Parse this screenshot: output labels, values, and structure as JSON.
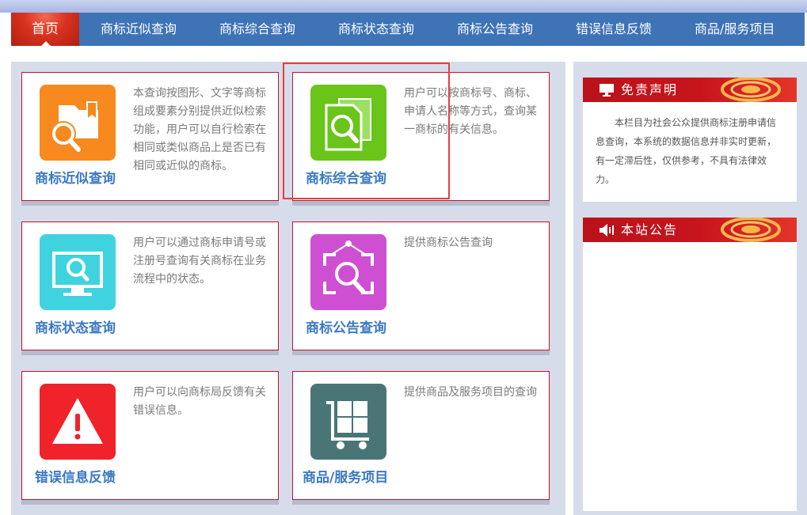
{
  "nav": {
    "home": "首页",
    "items": [
      "商标近似查询",
      "商标综合查询",
      "商标状态查询",
      "商标公告查询",
      "错误信息反馈",
      "商品/服务项目"
    ]
  },
  "cards": [
    {
      "title": "商标近似查询",
      "desc": "本查询按图形、文字等商标组成要素分别提供近似检索功能，用户可以自行检索在相同或类似商品上是否已有相同或近似的商标。",
      "icon": "folder-search-icon",
      "color": "#f7891e"
    },
    {
      "title": "商标综合查询",
      "desc": "用户可以按商标号、商标、申请人名称等方式，查询某一商标的有关信息。",
      "icon": "documents-search-icon",
      "color": "#69c51a"
    },
    {
      "title": "商标状态查询",
      "desc": "用户可以通过商标申请号或注册号查询有关商标在业务流程中的状态。",
      "icon": "monitor-search-icon",
      "color": "#3fd3e0"
    },
    {
      "title": "商标公告查询",
      "desc": "提供商标公告查询",
      "icon": "notice-board-search-icon",
      "color": "#cf4fd3"
    },
    {
      "title": "错误信息反馈",
      "desc": "用户可以向商标局反馈有关错误信息。",
      "icon": "warning-icon",
      "color": "#f0222a"
    },
    {
      "title": "商品/服务项目",
      "desc": "提供商品及服务项目的查询",
      "icon": "cart-icon",
      "color": "#4a7577"
    }
  ],
  "sidebar": {
    "disclaimer": {
      "title": "免责声明",
      "icon": "monitor-icon",
      "text": "本栏目为社会公众提供商标注册申请信息查询，本系统的数据信息并非实时更新，有一定滞后性，仅供参考，不具有法律效力。"
    },
    "notice": {
      "title": "本站公告",
      "icon": "speaker-icon"
    }
  },
  "colors": {
    "nav": "#3e73b6",
    "accent": "#c4102c",
    "title": "#3b79c2"
  }
}
